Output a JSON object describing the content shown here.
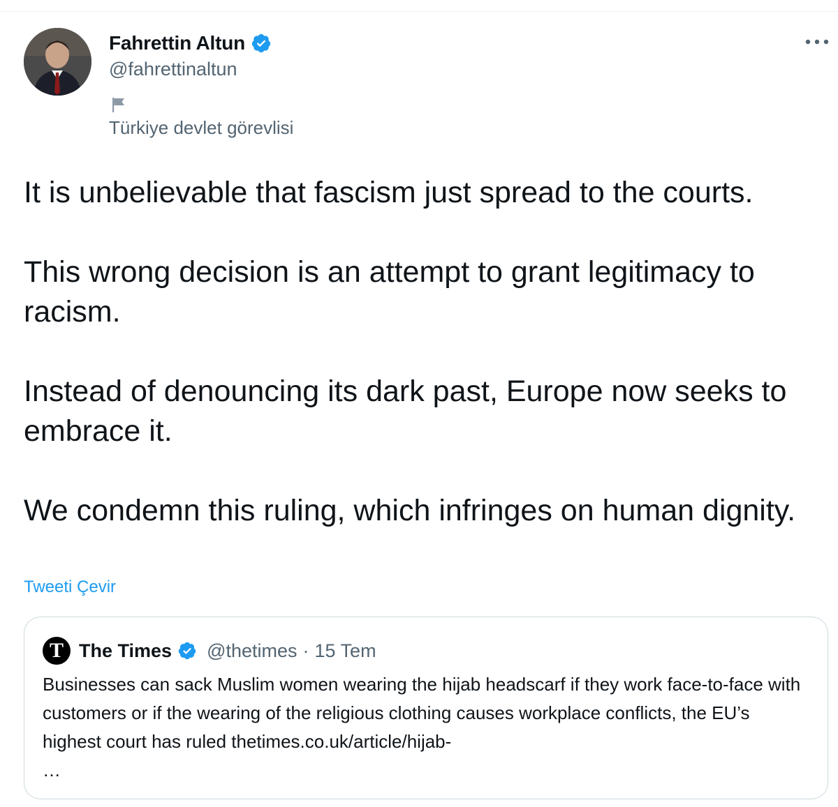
{
  "tweet": {
    "author": {
      "display_name": "Fahrettin Altun",
      "handle": "@fahrettinaltun",
      "verified_icon": "verified-badge-icon",
      "affiliation_icon": "flag-icon",
      "affiliation": "Türkiye devlet görevlisi"
    },
    "more_icon": "more-options-icon",
    "more_label": "•••",
    "paragraphs": [
      "It is unbelievable that fascism just spread to the courts.",
      "This wrong decision is an attempt to grant legitimacy to racism.",
      "Instead of denouncing its dark past, Europe now seeks to embrace it.",
      "We condemn this ruling, which infringes on human dignity."
    ],
    "translate_label": "Tweeti Çevir"
  },
  "quoted_tweet": {
    "logo_letter": "T",
    "display_name": "The Times",
    "handle": "@thetimes",
    "separator": "·",
    "date": "15 Tem",
    "text": "Businesses can sack Muslim women wearing the hijab headscarf if they work face-to-face with customers or if the wearing of the religious clothing causes workplace conflicts, the EU’s highest court has ruled thetimes.co.uk/article/hijab-\n…"
  },
  "colors": {
    "text_primary": "#0f1419",
    "text_secondary": "#536471",
    "link": "#1d9bf0",
    "verified": "#1d9bf0",
    "border": "#cfd9de"
  }
}
